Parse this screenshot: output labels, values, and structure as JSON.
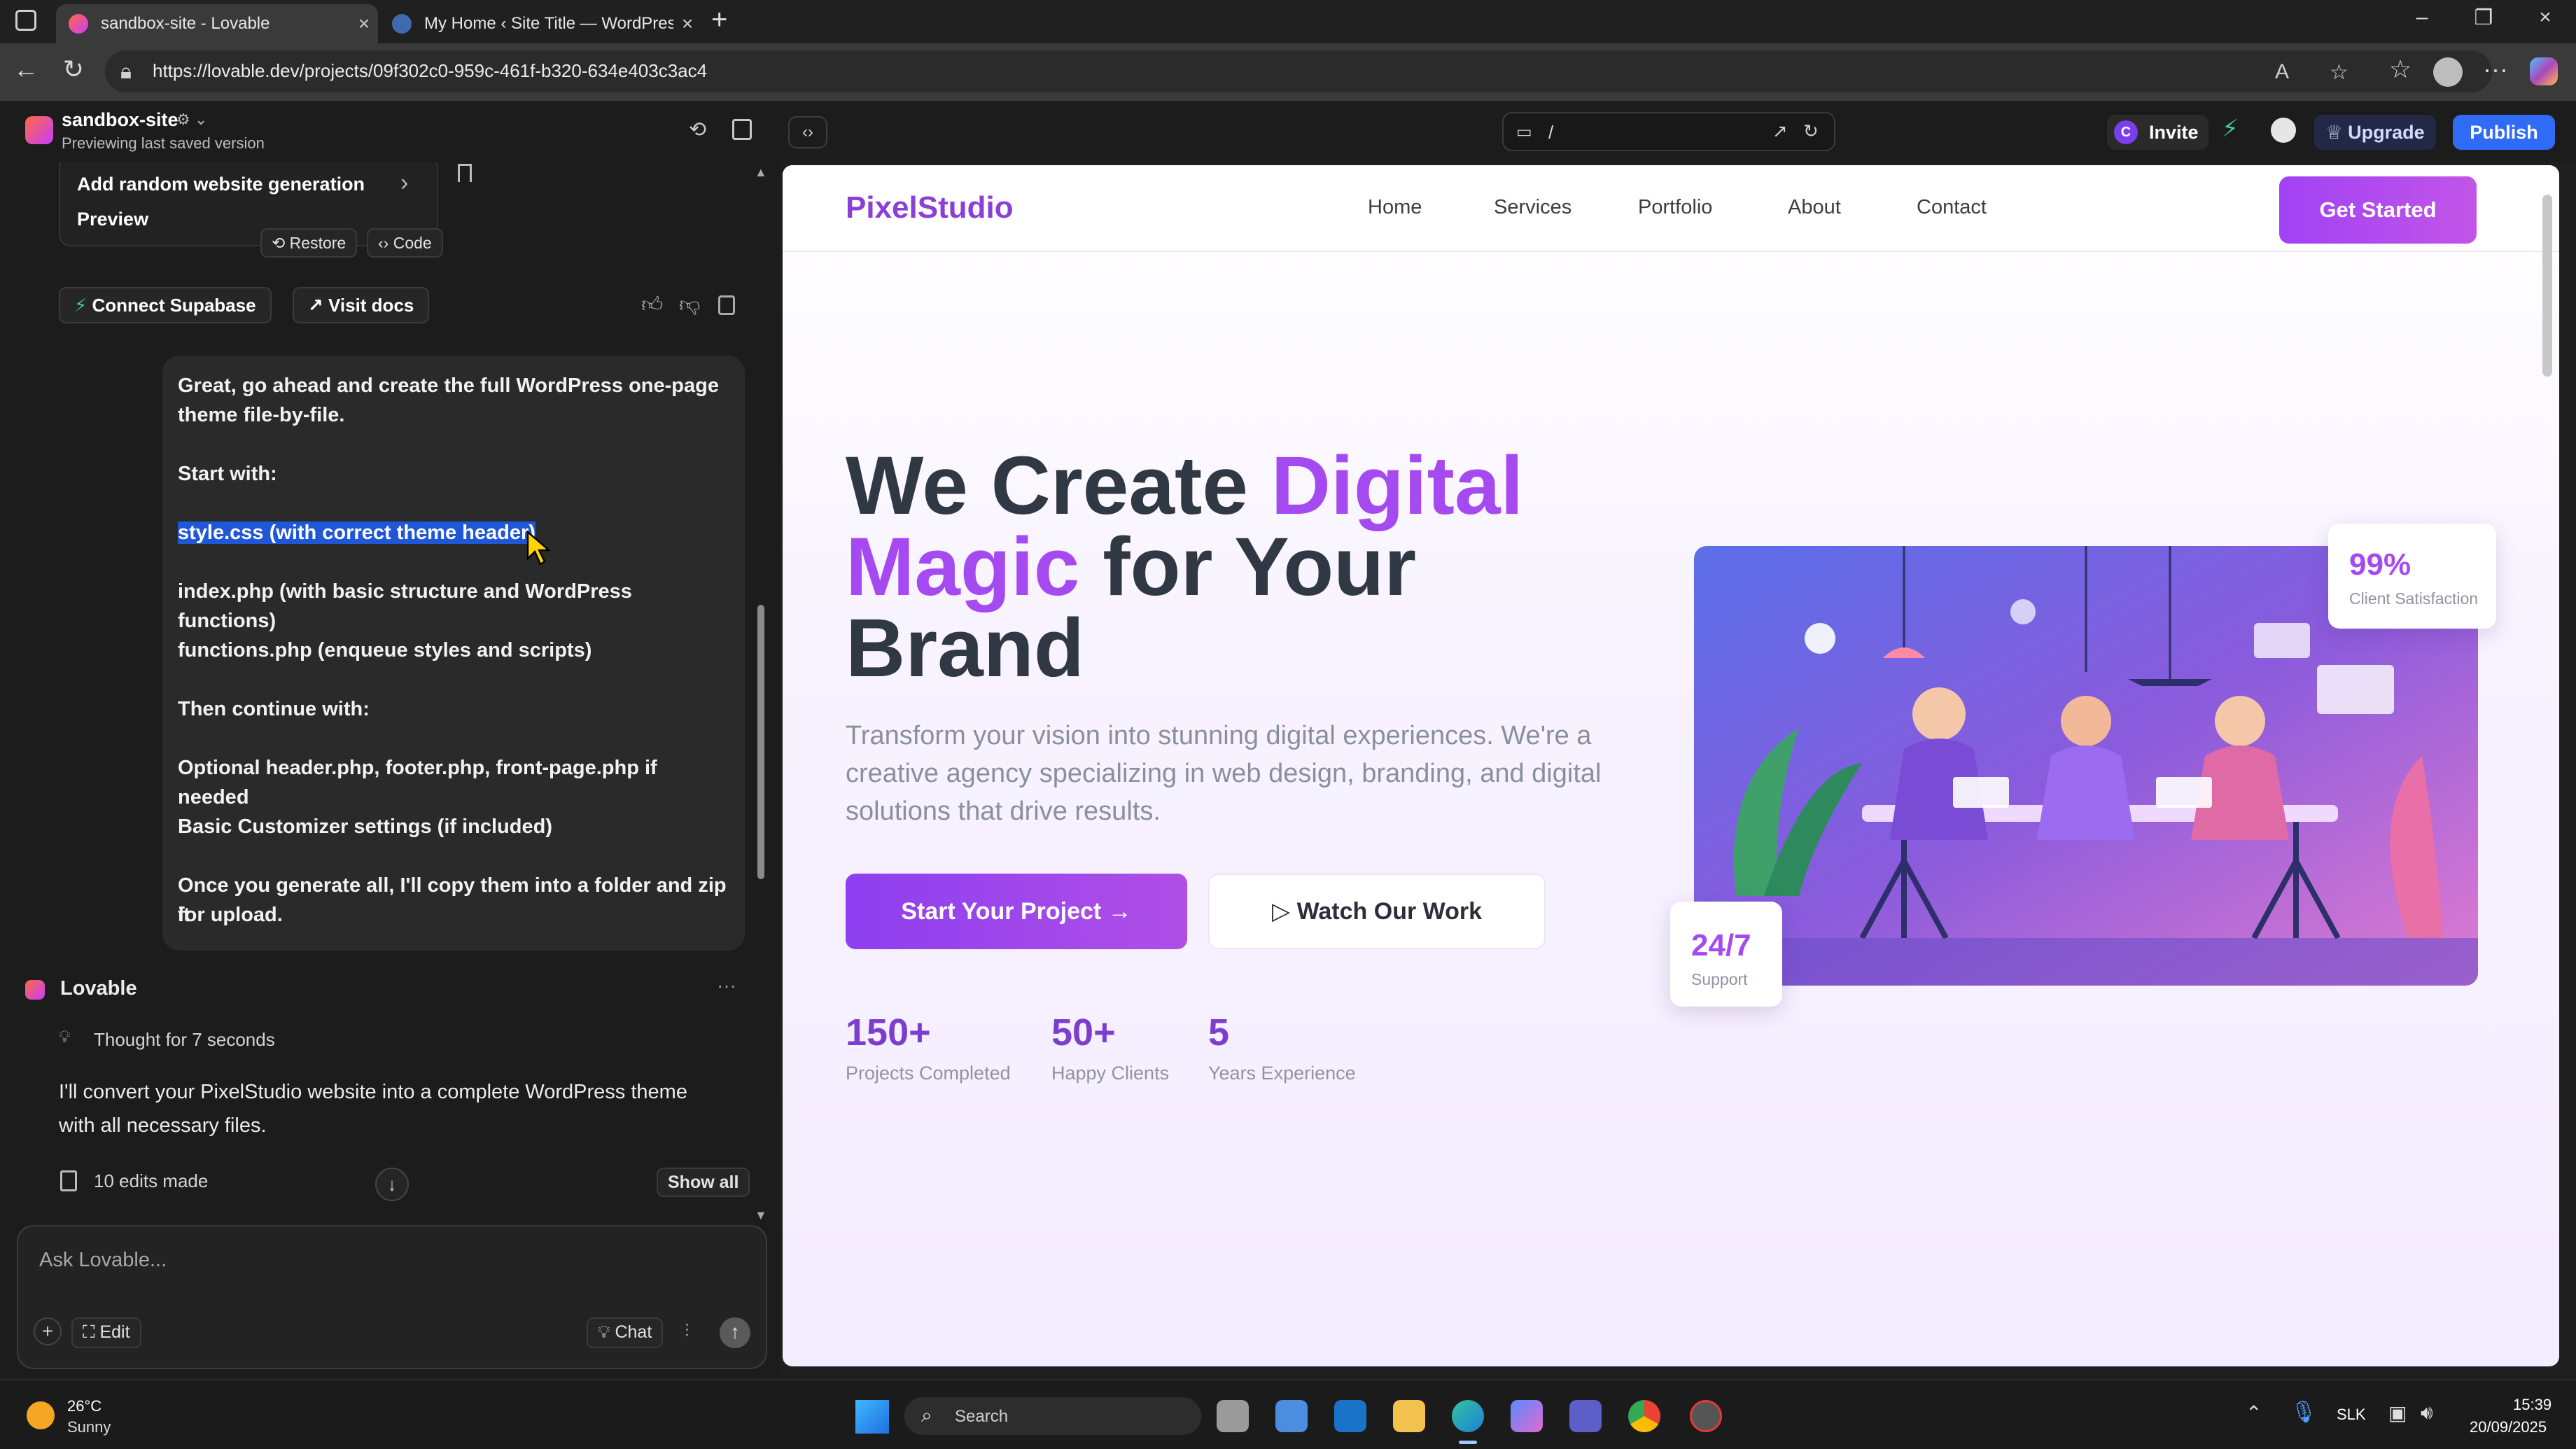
{
  "browser": {
    "tabs": [
      {
        "title": "sandbox-site - Lovable"
      },
      {
        "title": "My Home ‹ Site Title — WordPres"
      }
    ],
    "new_tab": "+",
    "url": "https://lovable.dev/projects/09f302c0-959c-461f-b320-634e403c3ac4"
  },
  "app_header": {
    "project_name": "sandbox-site",
    "project_status": "Previewing last saved version",
    "path": "/",
    "invite_label": "Invite",
    "invite_avatar": "C",
    "upgrade_label": "Upgrade",
    "publish_label": "Publish"
  },
  "chat": {
    "prev_card": {
      "line1": "Add random website generation",
      "line2": "Preview",
      "restore_label": "Restore",
      "code_label": "Code"
    },
    "connect_supabase": "Connect Supabase",
    "visit_docs": "Visit docs",
    "user_message": {
      "line1": "Great, go ahead and create the full WordPress one-page",
      "line2": "theme file-by-file.",
      "line3": "Start with:",
      "line4_highlighted": "style.css (with correct theme header)",
      "line5": "index.php (with basic structure and WordPress functions)",
      "line6": "functions.php (enqueue styles and scripts)",
      "line7": "Then continue with:",
      "line8": "Optional header.php, footer.php, front-page.php if needed",
      "line9": "Basic Customizer settings (if included)",
      "line10": "Once you generate all, I'll copy them into a folder and zip it",
      "line11": "for upload."
    },
    "assistant_name": "Lovable",
    "thought": "Thought for 7 seconds",
    "reply_line1": "I'll convert your PixelStudio website into a complete WordPress theme",
    "reply_line2": "with all necessary files.",
    "edits": "10 edits made",
    "show_all": "Show all",
    "input_placeholder": "Ask Lovable...",
    "edit_label": "Edit",
    "chat_label": "Chat"
  },
  "preview": {
    "brand": "PixelStudio",
    "nav": [
      "Home",
      "Services",
      "Portfolio",
      "About",
      "Contact"
    ],
    "cta": "Get Started",
    "hero_words": {
      "w1": "We Create ",
      "w2": "Digital",
      "w3": "Magic",
      "w4": " for Your",
      "w5": "Brand"
    },
    "hero_p": "Transform your vision into stunning digital experiences. We're a creative agency specializing in web design, branding, and digital solutions that drive results.",
    "btn_primary": "Start Your Project",
    "btn_secondary": "Watch Our Work",
    "stats": [
      {
        "value": "150+",
        "label": "Projects Completed"
      },
      {
        "value": "50+",
        "label": "Happy Clients"
      },
      {
        "value": "5",
        "label": "Years Experience"
      }
    ],
    "badge_satisfaction": {
      "value": "99%",
      "label": "Client Satisfaction"
    },
    "badge_support": {
      "value": "24/7",
      "label": "Support"
    },
    "accent_color": "#a54af0"
  },
  "taskbar": {
    "weather_temp": "26°C",
    "weather_desc": "Sunny",
    "search": "Search",
    "lang": "SLK",
    "time": "15:39",
    "date": "20/09/2025"
  }
}
